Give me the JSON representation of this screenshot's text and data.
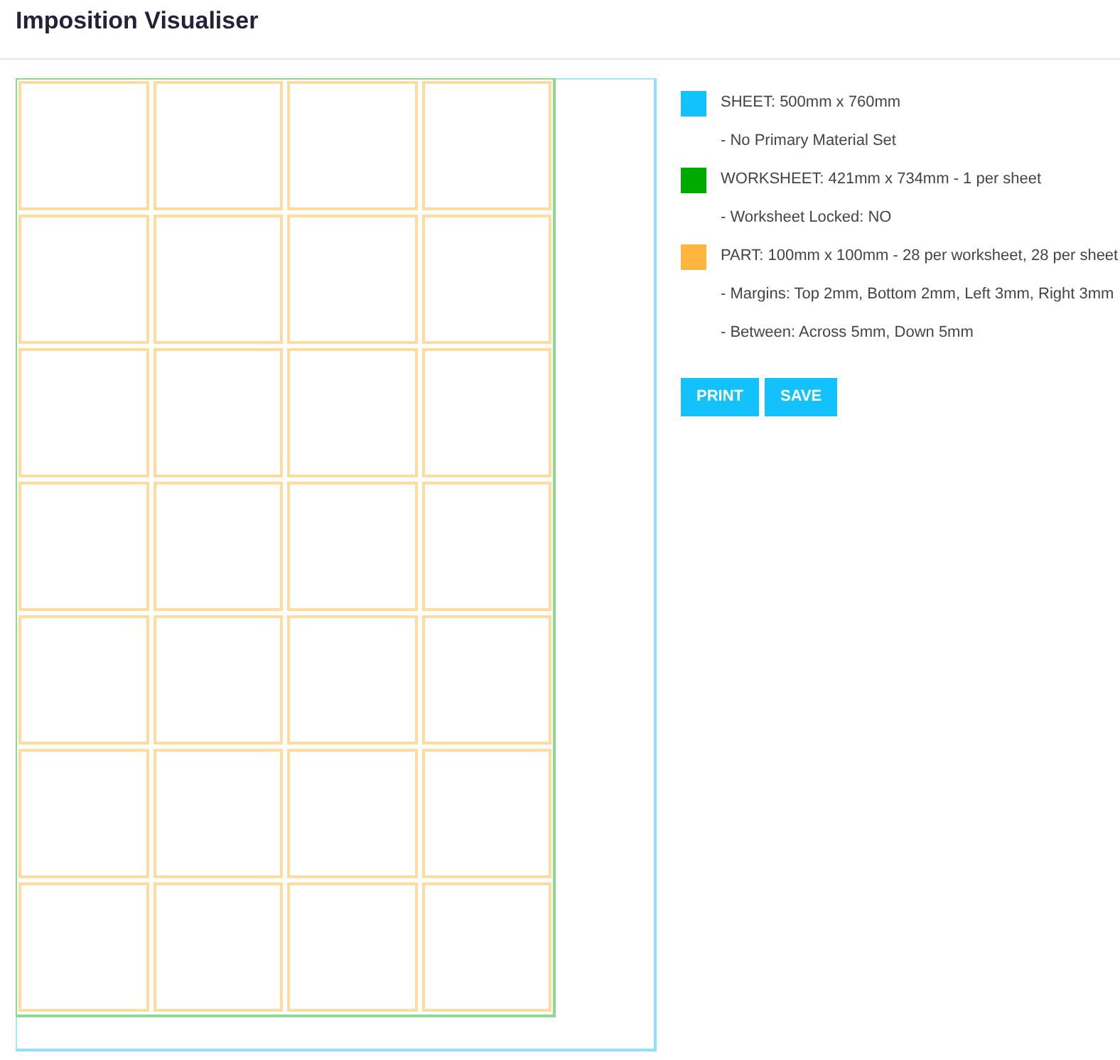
{
  "header": {
    "title": "Imposition Visualiser"
  },
  "legend": [
    {
      "kind": "swatch",
      "color": "#13c1fb",
      "text": "SHEET: 500mm x 760mm"
    },
    {
      "kind": "detail",
      "text": "- No Primary Material Set"
    },
    {
      "kind": "swatch",
      "color": "#00aa00",
      "text": "WORKSHEET: 421mm x 734mm - 1 per sheet"
    },
    {
      "kind": "detail",
      "text": "- Worksheet Locked: NO"
    },
    {
      "kind": "swatch",
      "color": "#ffb53d",
      "text": "PART: 100mm x 100mm - 28 per worksheet, 28 per sheet"
    },
    {
      "kind": "detail",
      "text": "- Margins: Top 2mm, Bottom 2mm, Left 3mm, Right 3mm"
    },
    {
      "kind": "detail",
      "text": "- Between: Across 5mm, Down 5mm"
    }
  ],
  "buttons": [
    "PRINT",
    "SAVE"
  ]
}
